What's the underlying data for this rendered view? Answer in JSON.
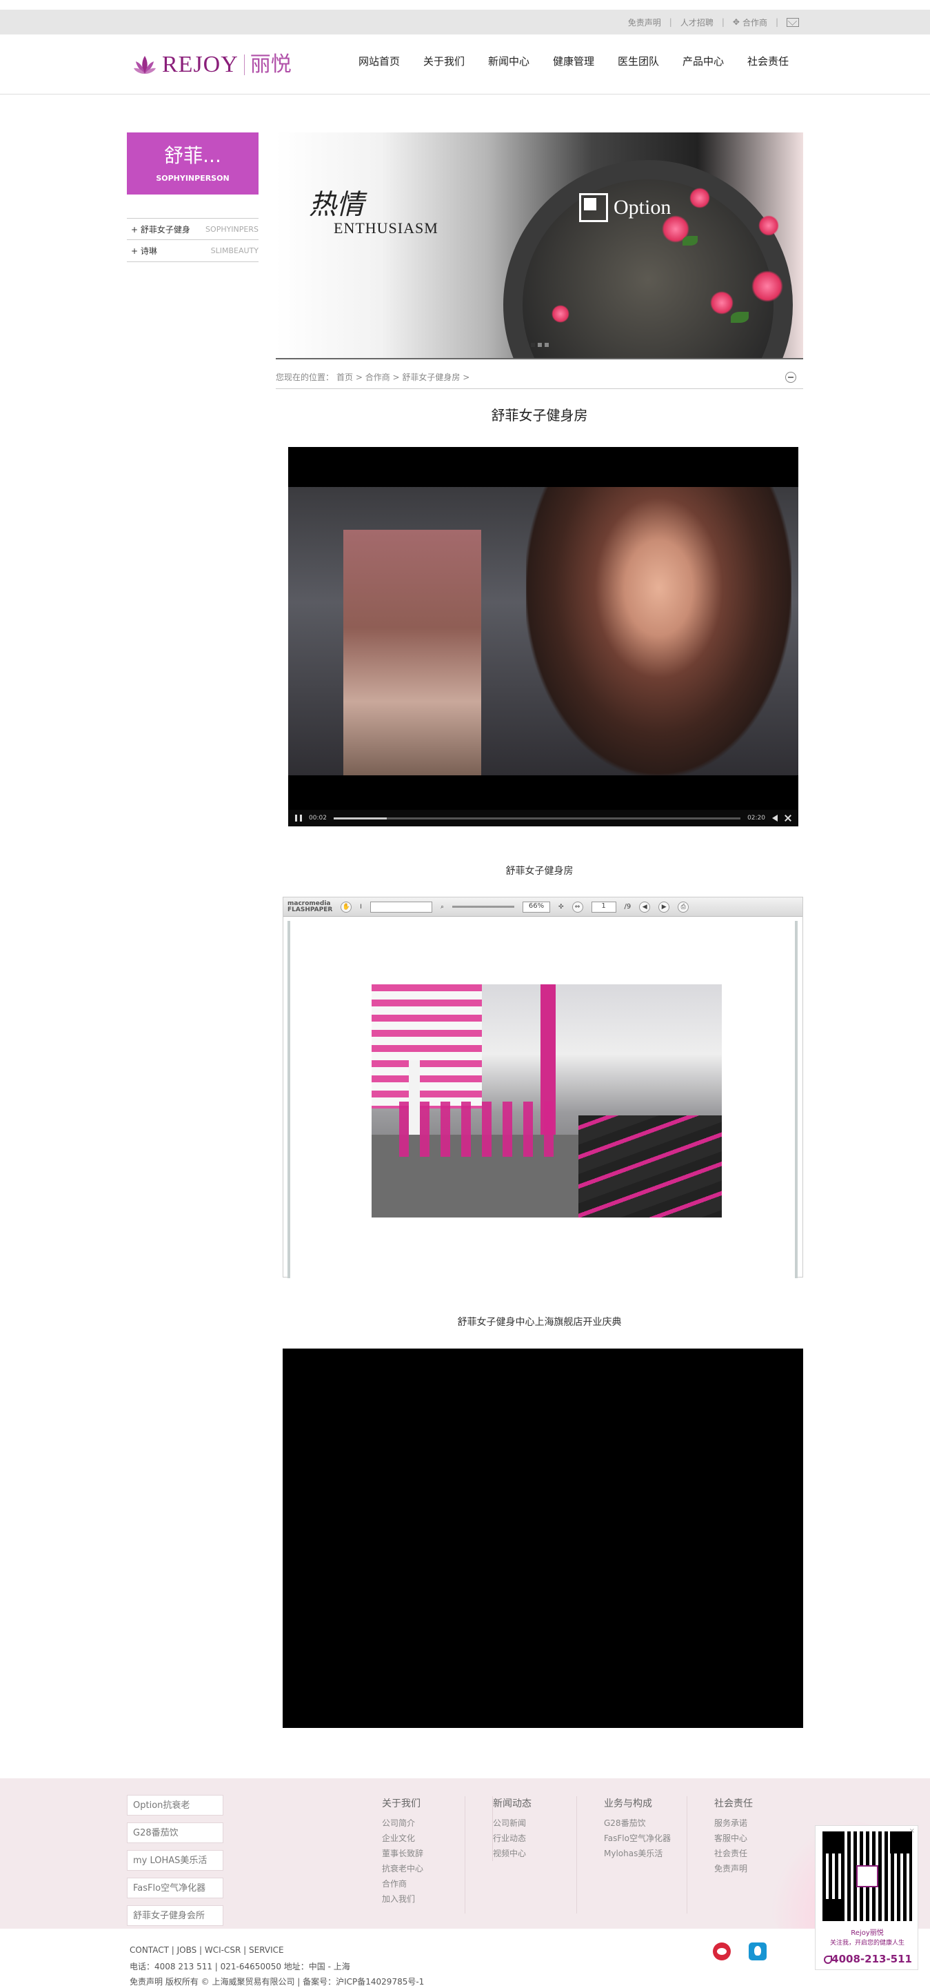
{
  "topbar": {
    "links": [
      "免责声明",
      "人才招聘",
      "合作商"
    ]
  },
  "header": {
    "logo_en": "REJOY",
    "logo_cn": "丽悦",
    "nav": [
      "网站首页",
      "关于我们",
      "新闻中心",
      "健康管理",
      "医生团队",
      "产品中心",
      "社会责任"
    ]
  },
  "sidebar": {
    "banner_title": "舒菲...",
    "banner_subtitle": "SOPHYINPERSON",
    "items": [
      {
        "cn": "+ 舒菲女子健身",
        "en": "SOPHYINPERS"
      },
      {
        "cn": "+ 诗琳",
        "en": "SLIMBEAUTY"
      }
    ]
  },
  "hero": {
    "cn_title": "热情",
    "en_title": "ENTHUSIASM",
    "brand": "Option"
  },
  "breadcrumb": {
    "label": "您现在的位置：",
    "path": "首页 > 合作商 > 舒菲女子健身房 >"
  },
  "article": {
    "title": "舒菲女子健身房",
    "video1": {
      "time_elapsed": "00:02",
      "time_total": "02:20",
      "progress": 0.13
    },
    "caption1": "舒菲女子健身房",
    "flashpaper": {
      "logo_top": "macromedia",
      "logo_bottom": "FLASHPAPER",
      "zoom": "66%",
      "page": "1",
      "pages": "/9"
    },
    "caption2": "舒菲女子健身中心上海旗舰店开业庆典"
  },
  "footer": {
    "links": [
      "Option抗衰老",
      "G28番茄饮",
      "my LOHAS美乐活",
      "FasFlo空气净化器",
      "舒菲女子健身会所"
    ],
    "columns": [
      {
        "title": "关于我们",
        "items": [
          "公司简介",
          "企业文化",
          "董事长致辞",
          "抗衰老中心",
          "合作商",
          "加入我们"
        ]
      },
      {
        "title": "新闻动态",
        "items": [
          "公司新闻",
          "行业动态",
          "视频中心"
        ]
      },
      {
        "title": "业务与构成",
        "items": [
          "G28番茄饮",
          "FasFlo空气净化器",
          "Mylohas美乐活"
        ]
      },
      {
        "title": "社会责任",
        "items": [
          "服务承诺",
          "客服中心",
          "社会责任",
          "免责声明"
        ]
      }
    ],
    "line1": "CONTACT  |  JOBS |  WCI-CSR |  SERVICE",
    "line2": "电话：4008 213 511 | 021-64650050 地址：中国 - 上海",
    "line3": "免责声明  版权所有 © 上海威聚贸易有限公司 | 备案号：沪ICP备14029785号-1"
  },
  "qr": {
    "label": "Rejoy丽悦",
    "slogan": "关注我，开启您的健康人生",
    "phone": "4008-213-511"
  },
  "colors": {
    "brand": "#8a1f7a",
    "accent": "#c34fc0",
    "footer_bg": "#f3e9ec"
  }
}
